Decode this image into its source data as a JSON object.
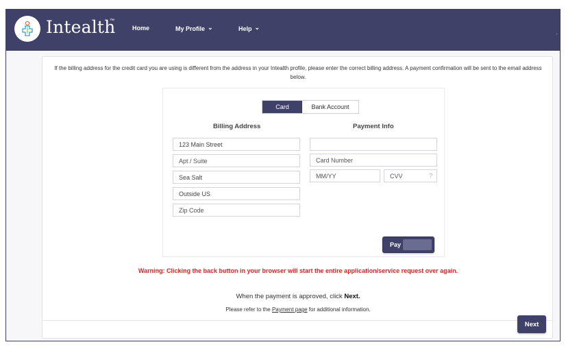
{
  "brand": {
    "name": "Intealth",
    "trademark": "™",
    "logo_icon": "cross-person-icon"
  },
  "nav": {
    "items": [
      {
        "label": "Home"
      },
      {
        "label": "My Profile",
        "icon": "chevron-down-icon"
      },
      {
        "label": "Help",
        "icon": "chevron-down-icon"
      }
    ]
  },
  "notice": "If the billing address for the credit card you are using is different from the address in your Intealth profile, please enter the correct billing address. A payment confirmation will be sent to the email address below.",
  "tabs": {
    "card": "Card",
    "bank": "Bank Account",
    "active": "Card"
  },
  "billing": {
    "title": "Billing Address",
    "street": {
      "value": "123 Main Street"
    },
    "apt": {
      "placeholder": "Apt / Suite"
    },
    "city": {
      "value": "Sea Salt"
    },
    "country": {
      "value": "Outside US"
    },
    "zip": {
      "placeholder": "Zip Code"
    }
  },
  "payment": {
    "title": "Payment Info",
    "name": {
      "value": ""
    },
    "card_number": {
      "placeholder": "Card Number"
    },
    "expiry": {
      "placeholder": "MM/YY"
    },
    "cvv": {
      "placeholder": "CVV",
      "help": "?"
    }
  },
  "pay_button": "Pay",
  "warning": "Warning: Clicking the back button in your browser will start the entire application/service request over again.",
  "approved": {
    "prefix": "When the payment is approved, click ",
    "strong": "Next."
  },
  "refer": {
    "prefix": "Please refer to the ",
    "link": "Payment page",
    "suffix": " for additional information."
  },
  "next_button": "Next",
  "colors": {
    "primary": "#3f4168",
    "warning": "#d62525",
    "background": "#f7f7f9"
  }
}
